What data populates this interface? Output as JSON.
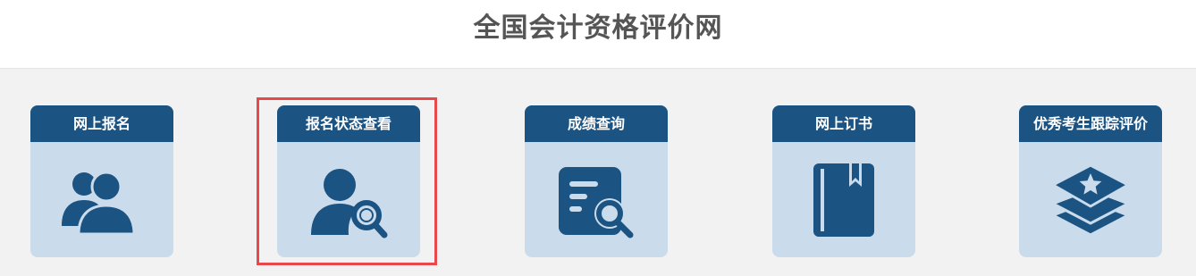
{
  "header": {
    "title": "全国会计资格评价网"
  },
  "cards": [
    {
      "label": "网上报名",
      "icon": "users-icon"
    },
    {
      "label": "报名状态查看",
      "icon": "user-search-icon"
    },
    {
      "label": "成绩查询",
      "icon": "document-search-icon"
    },
    {
      "label": "网上订书",
      "icon": "book-bookmark-icon"
    },
    {
      "label": "优秀考生跟踪评价",
      "icon": "layered-star-icon"
    }
  ],
  "colors": {
    "card_header": "#1b5383",
    "card_body": "#cadcec",
    "icon": "#1b5383",
    "highlight": "#e8474b",
    "title_text": "#555555",
    "page_bg": "#f2f2f2"
  }
}
